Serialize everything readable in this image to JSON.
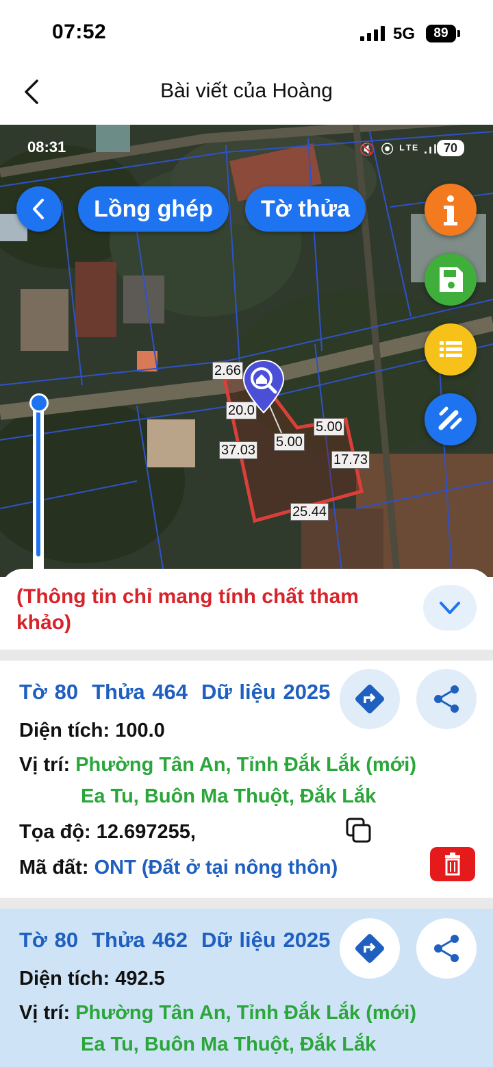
{
  "status_bar": {
    "time": "07:52",
    "network": "5G",
    "battery": "89"
  },
  "nav": {
    "title": "Bài viết của Hoàng"
  },
  "map": {
    "inner_time": "08:31",
    "inner_icons": "🔇 ⦿ ᴸᵀᴱ .ıl",
    "inner_battery": "70",
    "pill_1": "Lồng ghép",
    "pill_2": "Tờ thửa",
    "dimensions": [
      "2.66",
      "20.0",
      "5.00",
      "5.00",
      "37.03",
      "17.73",
      "25.44"
    ],
    "fab_colors": {
      "info": "#f47a20",
      "save": "#3fae3b",
      "list": "#f6c21a",
      "tool": "#1e74f0"
    }
  },
  "sheet": {
    "note": "(Thông tin chỉ mang tính chất tham khảo)"
  },
  "parcels": [
    {
      "to": "Tờ 80",
      "thua": "Thửa 464",
      "du_lieu": "Dữ liệu 2025",
      "dien_tich_label": "Diện tích:",
      "dien_tich": "100.0",
      "vi_tri_label": "Vị trí:",
      "vi_tri_1": "Phường Tân An, Tỉnh Đắk Lắk (mới)",
      "vi_tri_2": "Ea Tu, Buôn Ma Thuột, Đắk Lắk",
      "toa_do_label": "Tọa độ:",
      "toa_do": "12.697255,",
      "ma_dat_label": "Mã đất:",
      "ma_dat": "ONT (Đất ở tại nông thôn)"
    },
    {
      "to": "Tờ 80",
      "thua": "Thửa 462",
      "du_lieu": "Dữ liệu 2025",
      "dien_tich_label": "Diện tích:",
      "dien_tich": "492.5",
      "vi_tri_label": "Vị trí:",
      "vi_tri_1": "Phường Tân An, Tỉnh Đắk Lắk (mới)",
      "vi_tri_2": "Ea Tu, Buôn Ma Thuột, Đắk Lắk"
    }
  ]
}
